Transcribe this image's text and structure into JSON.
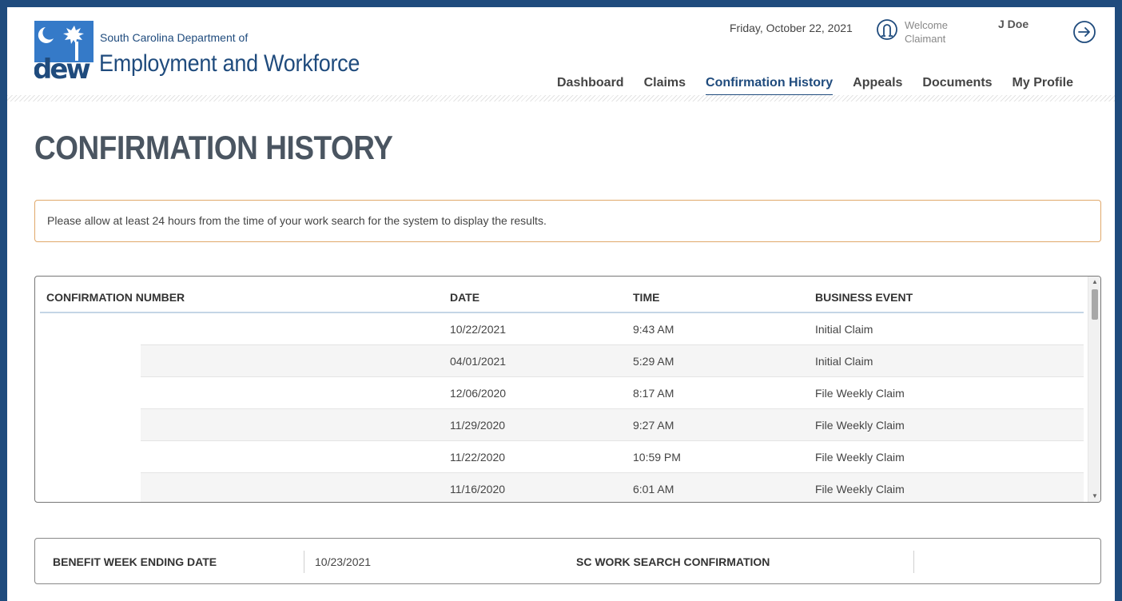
{
  "header": {
    "agency_line1": "South Carolina Department of",
    "agency_line2": "Employment and Workforce",
    "logo_text": "dew",
    "date": "Friday, October 22, 2021",
    "welcome_line1": "Welcome",
    "welcome_line2": "Claimant",
    "user_name": "J Doe",
    "brand_color": "#1f4b7d"
  },
  "nav": {
    "items": [
      {
        "label": "Dashboard",
        "active": false
      },
      {
        "label": "Claims",
        "active": false
      },
      {
        "label": "Confirmation History",
        "active": true
      },
      {
        "label": "Appeals",
        "active": false
      },
      {
        "label": "Documents",
        "active": false
      },
      {
        "label": "My Profile",
        "active": false
      }
    ]
  },
  "page": {
    "title": "CONFIRMATION HISTORY",
    "notice": "Please allow at least 24 hours from the time of your work search for the system to display the results."
  },
  "table": {
    "headers": [
      "CONFIRMATION NUMBER",
      "DATE",
      "TIME",
      "BUSINESS EVENT"
    ],
    "rows": [
      {
        "date": "10/22/2021",
        "time": "9:43 AM",
        "event": "Initial Claim"
      },
      {
        "date": "04/01/2021",
        "time": "5:29 AM",
        "event": "Initial Claim"
      },
      {
        "date": "12/06/2020",
        "time": "8:17 AM",
        "event": "File Weekly Claim"
      },
      {
        "date": "11/29/2020",
        "time": "9:27 AM",
        "event": "File Weekly Claim"
      },
      {
        "date": "11/22/2020",
        "time": "10:59 PM",
        "event": "File Weekly Claim"
      },
      {
        "date": "11/16/2020",
        "time": "6:01 AM",
        "event": "File Weekly Claim"
      }
    ]
  },
  "benefit": {
    "week_ending_label": "BENEFIT WEEK ENDING DATE",
    "week_ending_value": "10/23/2021",
    "work_search_label": "SC WORK SEARCH CONFIRMATION",
    "work_search_value": ""
  }
}
